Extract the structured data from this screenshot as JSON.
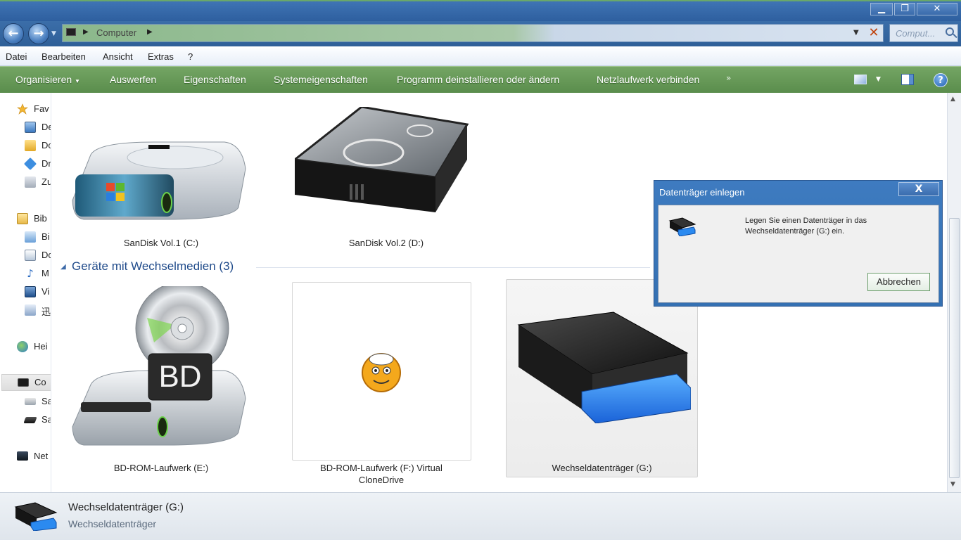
{
  "window": {
    "minimize_glyph": "▁",
    "maximize_glyph": "❐",
    "close_glyph": "✕"
  },
  "address": {
    "path": "Computer",
    "search_placeholder": "Comput..."
  },
  "menu": [
    "Datei",
    "Bearbeiten",
    "Ansicht",
    "Extras",
    "?"
  ],
  "toolbar": {
    "organize": "Organisieren",
    "eject": "Auswerfen",
    "properties": "Eigenschaften",
    "system_properties": "Systemeigenschaften",
    "uninstall": "Programm deinstallieren oder ändern",
    "map_drive": "Netzlaufwerk verbinden",
    "more": "»"
  },
  "sidebar": {
    "items": [
      {
        "label": "Fav",
        "icon": "star-icon"
      },
      {
        "label": "De",
        "icon": "desktop-icon"
      },
      {
        "label": "Do",
        "icon": "downloads-icon"
      },
      {
        "label": "Dr",
        "icon": "dropbox-icon"
      },
      {
        "label": "Zu",
        "icon": "recent-places-icon"
      },
      {
        "label": "Bib",
        "icon": "libraries-icon"
      },
      {
        "label": "Bi",
        "icon": "pictures-icon"
      },
      {
        "label": "Do",
        "icon": "documents-icon"
      },
      {
        "label": "M",
        "icon": "music-icon"
      },
      {
        "label": "Vi",
        "icon": "videos-icon"
      },
      {
        "label": "迅",
        "icon": "xunlei-icon"
      },
      {
        "label": "Hei",
        "icon": "homegroup-icon"
      },
      {
        "label": "Co",
        "icon": "computer-icon"
      },
      {
        "label": "Sa",
        "icon": "drive-c-icon"
      },
      {
        "label": "Sa",
        "icon": "drive-d-icon"
      },
      {
        "label": "Net",
        "icon": "network-icon"
      }
    ]
  },
  "drives": {
    "c": "SanDisk Vol.1 (C:)",
    "d": "SanDisk Vol.2 (D:)",
    "group_title": "Geräte mit Wechselmedien (3)",
    "e": "BD-ROM-Laufwerk (E:)",
    "f_line1": "BD-ROM-Laufwerk (F:) Virtual",
    "f_line2": "CloneDrive",
    "g": "Wechseldatenträger (G:)",
    "bd_badge": "BD"
  },
  "details": {
    "name": "Wechseldatenträger (G:)",
    "type": "Wechseldatenträger"
  },
  "dialog": {
    "title": "Datenträger einlegen",
    "message": "Legen Sie einen Datenträger in das Wechseldatenträger (G:) ein.",
    "cancel": "Abbrechen",
    "close_glyph": "X"
  }
}
